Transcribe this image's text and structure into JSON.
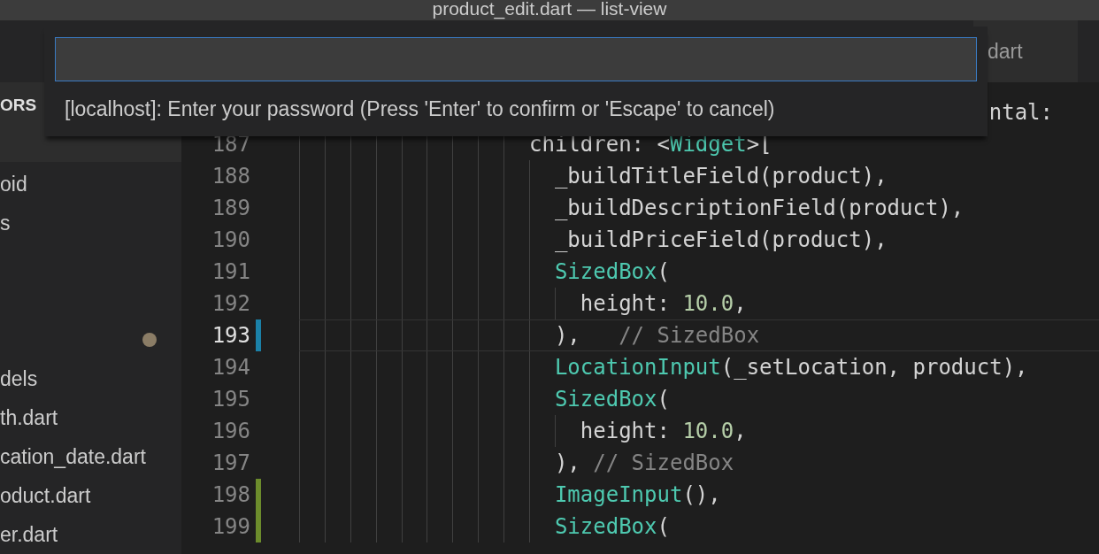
{
  "window": {
    "title": "product_edit.dart — list-view"
  },
  "sidebar": {
    "header": "ORS",
    "items": [
      {
        "label": "oid",
        "modified": false
      },
      {
        "label": "s",
        "modified": false
      },
      {
        "modified": false
      },
      {
        "modified": false
      },
      {
        "modified": true
      },
      {
        "label": "dels",
        "modified": false
      },
      {
        "label": "th.dart",
        "modified": false
      },
      {
        "label": "cation_date.dart",
        "modified": false
      },
      {
        "label": "oduct.dart",
        "modified": false
      },
      {
        "label": "er.dart",
        "modified": false
      }
    ]
  },
  "tabs": [
    {
      "label": "dart",
      "selected": true
    }
  ],
  "editor": {
    "lines": [
      {
        "current": false,
        "tokens": [
          {
            "kind": "plain",
            "text": "ntal:"
          }
        ]
      },
      {
        "number": "187",
        "current": false,
        "tokens": [
          {
            "kind": "plain",
            "text": "                  children: <"
          },
          {
            "kind": "type",
            "text": "Widget"
          },
          {
            "kind": "plain",
            "text": ">["
          }
        ]
      },
      {
        "number": "188",
        "current": false,
        "tokens": [
          {
            "kind": "plain",
            "text": "                    _buildTitleField(product),"
          }
        ]
      },
      {
        "number": "189",
        "current": false,
        "tokens": [
          {
            "kind": "plain",
            "text": "                    _buildDescriptionField(product),"
          }
        ]
      },
      {
        "number": "190",
        "current": false,
        "tokens": [
          {
            "kind": "plain",
            "text": "                    _buildPriceField(product),"
          }
        ]
      },
      {
        "number": "191",
        "current": false,
        "tokens": [
          {
            "kind": "type",
            "text": "                    SizedBox"
          },
          {
            "kind": "plain",
            "text": "("
          }
        ]
      },
      {
        "number": "192",
        "current": false,
        "tokens": [
          {
            "kind": "plain",
            "text": "                      height: "
          },
          {
            "kind": "number",
            "text": "10.0"
          },
          {
            "kind": "plain",
            "text": ","
          }
        ]
      },
      {
        "number": "193",
        "current": true,
        "color": "#1b81a8",
        "tokens": [
          {
            "kind": "plain",
            "text": "                    ),   "
          },
          {
            "kind": "comment",
            "text": "// SizedBox"
          }
        ]
      },
      {
        "number": "194",
        "current": false,
        "tokens": [
          {
            "kind": "type",
            "text": "                    LocationInput"
          },
          {
            "kind": "plain",
            "text": "(_setLocation, product),"
          }
        ]
      },
      {
        "number": "195",
        "current": false,
        "tokens": [
          {
            "kind": "type",
            "text": "                    SizedBox"
          },
          {
            "kind": "plain",
            "text": "("
          }
        ]
      },
      {
        "number": "196",
        "current": false,
        "tokens": [
          {
            "kind": "plain",
            "text": "                      height: "
          },
          {
            "kind": "number",
            "text": "10.0"
          },
          {
            "kind": "plain",
            "text": ","
          }
        ]
      },
      {
        "number": "197",
        "current": false,
        "tokens": [
          {
            "kind": "plain",
            "text": "                    ), "
          },
          {
            "kind": "comment",
            "text": "// SizedBox"
          }
        ]
      },
      {
        "number": "198",
        "current": false,
        "color": "#6c8c2c",
        "tokens": [
          {
            "kind": "type",
            "text": "                    ImageInput"
          },
          {
            "kind": "plain",
            "text": "(),"
          }
        ]
      },
      {
        "number": "199",
        "current": false,
        "color": "#6c8c2c",
        "tokens": [
          {
            "kind": "type",
            "text": "                    SizedBox"
          },
          {
            "kind": "plain",
            "text": "("
          }
        ]
      }
    ]
  },
  "prompt": {
    "message": "[localhost]: Enter your password (Press 'Enter' to confirm or 'Escape' to cancel)"
  }
}
